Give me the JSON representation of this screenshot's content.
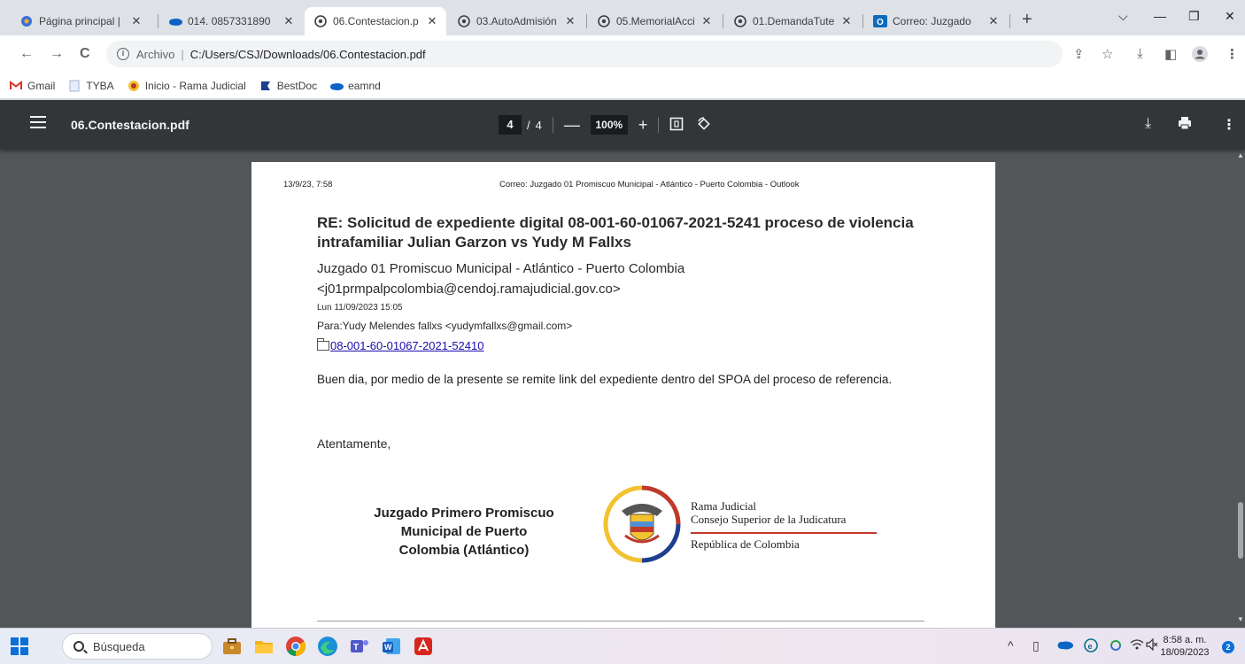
{
  "browser": {
    "tabs": [
      {
        "title": "Página principal |",
        "icon": "gear-colorful-icon",
        "active": false
      },
      {
        "title": "014. 0857331890",
        "icon": "onedrive-cloud-icon",
        "active": false
      },
      {
        "title": "06.Contestacion.p",
        "icon": "chrome-generic-icon",
        "active": true
      },
      {
        "title": "03.AutoAdmisión",
        "icon": "chrome-generic-icon",
        "active": false
      },
      {
        "title": "05.MemorialAcci",
        "icon": "chrome-generic-icon",
        "active": false
      },
      {
        "title": "01.DemandaTute",
        "icon": "chrome-generic-icon",
        "active": false
      },
      {
        "title": "Correo: Juzgado",
        "icon": "outlook-icon",
        "active": false
      }
    ],
    "new_tab": "+",
    "window_controls": {
      "tab_search": "⌵",
      "minimize": "—",
      "restore": "❐",
      "close": "✕"
    },
    "address": {
      "scheme_label": "Archivo",
      "path": "C:/Users/CSJ/Downloads/06.Contestacion.pdf"
    },
    "bookmarks": [
      {
        "label": "Gmail",
        "icon": "gmail-icon"
      },
      {
        "label": "TYBA",
        "icon": "file-icon"
      },
      {
        "label": "Inicio - Rama Judicial",
        "icon": "seal-icon"
      },
      {
        "label": "BestDoc",
        "icon": "bestdoc-icon"
      },
      {
        "label": "eamnd",
        "icon": "cloud-icon"
      }
    ]
  },
  "pdf_viewer": {
    "file_name": "06.Contestacion.pdf",
    "current_page": "4",
    "page_separator": "/",
    "total_pages": "4",
    "zoom": "100%",
    "zoom_out": "—",
    "zoom_in": "+"
  },
  "document": {
    "header_left": "13/9/23, 7:58",
    "header_center": "Correo: Juzgado 01 Promiscuo Municipal - Atlántico - Puerto Colombia - Outlook",
    "subject": "RE: Solicitud de expediente digital 08-001-60-01067-2021-5241 proceso de violencia intrafamiliar Julian Garzon vs Yudy M Fallxs",
    "from_name": "Juzgado 01 Promiscuo Municipal - Atlántico - Puerto Colombia",
    "from_email": "<j01prmpalpcolombia@cendoj.ramajudicial.gov.co>",
    "date": "Lun 11/09/2023 15:05",
    "to": "Para:Yudy Melendes fallxs <yudymfallxs@gmail.com>",
    "attachment_link": "08-001-60-01067-2021-52410",
    "body": "Buen dia, por medio de la presente se remite link del expediente dentro del SPOA del proceso de referencia.",
    "closing": "Atentamente,",
    "signature_line1": "Juzgado Primero Promiscuo",
    "signature_line2": "Municipal de Puerto",
    "signature_line3": "Colombia (Atlántico)",
    "logo_line1": "Rama Judicial",
    "logo_line2": "Consejo Superior de la Judicatura",
    "logo_line3": "República de Colombia"
  },
  "taskbar": {
    "search_placeholder": "Búsqueda",
    "apps": [
      "briefcase-app-icon",
      "file-explorer-icon",
      "chrome-icon",
      "edge-icon",
      "teams-icon",
      "word-icon",
      "acrobat-icon"
    ],
    "time": "8:58 a. m.",
    "date": "18/09/2023",
    "notification_count": "2"
  }
}
